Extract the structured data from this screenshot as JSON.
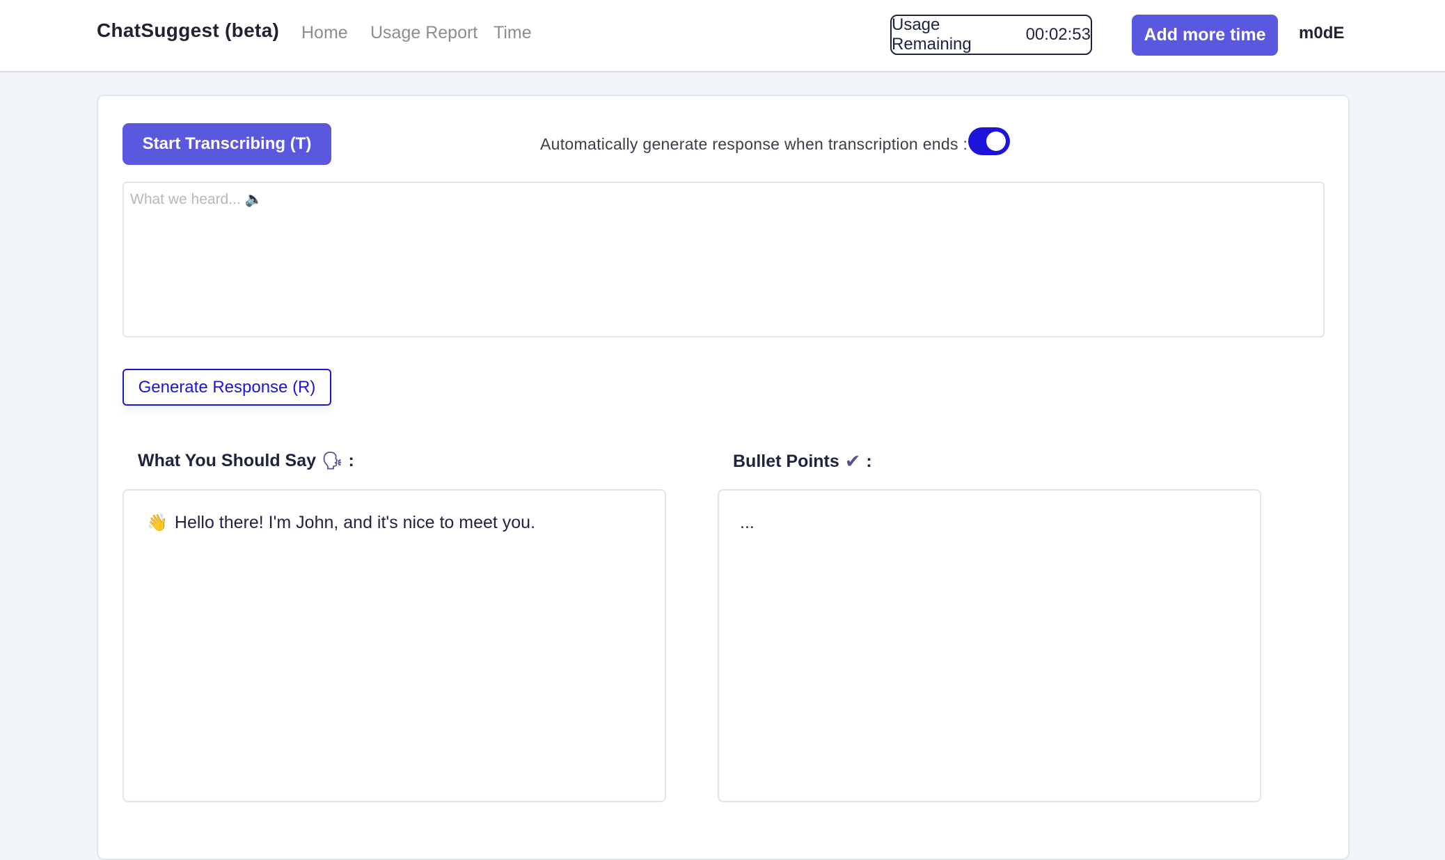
{
  "navbar": {
    "brand": "ChatSuggest (beta)",
    "links": [
      "Home",
      "Usage Report",
      "Time"
    ],
    "usage_label": "Usage Remaining",
    "usage_value": "00:02:53",
    "add_time_label": "Add more time",
    "username": "m0dE"
  },
  "main": {
    "start_button": "Start Transcribing (T)",
    "auto_label": "Automatically generate response when transcription ends :",
    "auto_toggle_on": true,
    "transcript_placeholder": "What we heard... 🔈",
    "generate_button": "Generate Response (R)",
    "say_title": "What You Should Say",
    "say_icon": "🗣",
    "say_text": "Hello there! I'm John, and it's nice to meet you.",
    "say_text_icon": "👋",
    "bullets_title": "Bullet Points",
    "bullets_icon": "✔",
    "bullets_text": "...",
    "colon": ":"
  },
  "colors": {
    "accent": "#5b58e0",
    "toggle": "#1c14d9",
    "text": "#1e1e3c"
  }
}
